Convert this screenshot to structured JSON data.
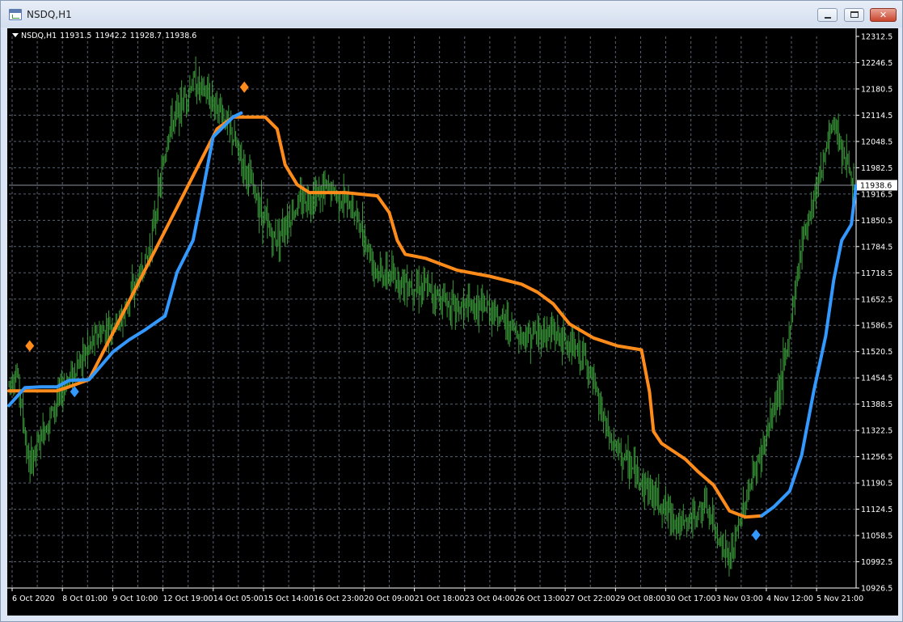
{
  "window": {
    "title": "NSDQ,H1",
    "close_glyph": "✕"
  },
  "info_bar": {
    "symbol": "NSDQ,H1",
    "open": "11931.5",
    "high": "11942.2",
    "low": "11928.7",
    "close": "11938.6"
  },
  "colors": {
    "background": "#000000",
    "grid": "#596273",
    "candles": "#3a9a3a",
    "upper_line": "#ff8c1a",
    "lower_line": "#3399ff",
    "axis_text": "#ffffff",
    "current_price_bg": "#ffffff"
  },
  "chart_data": {
    "type": "line",
    "symbol": "NSDQ",
    "timeframe": "H1",
    "current_price": 11938.6,
    "ylim": [
      10926.6,
      12312.5
    ],
    "y_ticks": [
      "12312.5",
      "12246.5",
      "12180.5",
      "12114.5",
      "12048.5",
      "11982.5",
      "11916.5",
      "11850.5",
      "11784.5",
      "11718.5",
      "11652.5",
      "11586.5",
      "11520.5",
      "11454.5",
      "11388.5",
      "11322.5",
      "11256.5",
      "11190.5",
      "11124.5",
      "11058.5",
      "10992.5",
      "10926.5"
    ],
    "x_ticks": [
      "6 Oct 2020",
      "8 Oct 01:00",
      "9 Oct 10:00",
      "12 Oct 19:00",
      "14 Oct 05:00",
      "15 Oct 14:00",
      "16 Oct 23:00",
      "20 Oct 09:00",
      "21 Oct 18:00",
      "23 Oct 04:00",
      "26 Oct 13:00",
      "27 Oct 22:00",
      "29 Oct 08:00",
      "30 Oct 17:00",
      "3 Nov 03:00",
      "4 Nov 12:00",
      "5 Nov 21:00"
    ],
    "bars_count": 720,
    "price_path": [
      [
        0,
        11440
      ],
      [
        10,
        11470
      ],
      [
        25,
        11230
      ],
      [
        45,
        11330
      ],
      [
        70,
        11440
      ],
      [
        110,
        11560
      ],
      [
        140,
        11600
      ],
      [
        175,
        11770
      ],
      [
        200,
        12080
      ],
      [
        230,
        12200
      ],
      [
        265,
        12130
      ],
      [
        295,
        11980
      ],
      [
        330,
        11800
      ],
      [
        365,
        11900
      ],
      [
        400,
        11930
      ],
      [
        430,
        11880
      ],
      [
        460,
        11720
      ],
      [
        490,
        11700
      ],
      [
        520,
        11680
      ],
      [
        560,
        11630
      ],
      [
        600,
        11630
      ],
      [
        640,
        11560
      ],
      [
        680,
        11570
      ],
      [
        720,
        11500
      ],
      [
        750,
        11300
      ],
      [
        780,
        11220
      ],
      [
        810,
        11150
      ],
      [
        840,
        11080
      ],
      [
        870,
        11130
      ],
      [
        900,
        10990
      ],
      [
        920,
        11150
      ],
      [
        945,
        11300
      ],
      [
        970,
        11500
      ],
      [
        990,
        11800
      ],
      [
        1010,
        11950
      ],
      [
        1030,
        12100
      ],
      [
        1055,
        11940
      ]
    ],
    "series": [
      {
        "name": "upper",
        "color": "#ff8c1a",
        "points": [
          [
            0,
            11422
          ],
          [
            60,
            11422
          ],
          [
            75,
            11432
          ],
          [
            100,
            11450
          ],
          [
            260,
            12080
          ],
          [
            280,
            12110
          ],
          [
            320,
            12110
          ],
          [
            335,
            12080
          ],
          [
            345,
            11990
          ],
          [
            360,
            11940
          ],
          [
            375,
            11920
          ],
          [
            420,
            11920
          ],
          [
            460,
            11912
          ],
          [
            475,
            11870
          ],
          [
            485,
            11800
          ],
          [
            495,
            11765
          ],
          [
            520,
            11755
          ],
          [
            560,
            11725
          ],
          [
            600,
            11710
          ],
          [
            640,
            11690
          ],
          [
            660,
            11670
          ],
          [
            680,
            11640
          ],
          [
            700,
            11590
          ],
          [
            730,
            11555
          ],
          [
            760,
            11535
          ],
          [
            790,
            11525
          ],
          [
            800,
            11420
          ],
          [
            805,
            11320
          ],
          [
            815,
            11290
          ],
          [
            830,
            11270
          ],
          [
            845,
            11250
          ],
          [
            860,
            11220
          ],
          [
            880,
            11185
          ],
          [
            900,
            11120
          ],
          [
            920,
            11105
          ],
          [
            940,
            11108
          ]
        ]
      },
      {
        "name": "lower",
        "color": "#3399ff",
        "points": [
          [
            0,
            11385
          ],
          [
            20,
            11430
          ],
          [
            40,
            11432
          ],
          [
            60,
            11432
          ],
          [
            75,
            11448
          ],
          [
            100,
            11450
          ],
          [
            130,
            11520
          ],
          [
            150,
            11550
          ],
          [
            170,
            11575
          ],
          [
            195,
            11610
          ],
          [
            210,
            11720
          ],
          [
            230,
            11800
          ],
          [
            240,
            11900
          ],
          [
            255,
            12060
          ],
          [
            280,
            12110
          ],
          [
            290,
            12120
          ],
          [
            940,
            11108
          ],
          [
            955,
            11130
          ],
          [
            975,
            11170
          ],
          [
            990,
            11260
          ],
          [
            1005,
            11420
          ],
          [
            1020,
            11560
          ],
          [
            1030,
            11700
          ],
          [
            1040,
            11800
          ],
          [
            1052,
            11840
          ],
          [
            1058,
            11938
          ]
        ]
      }
    ],
    "markers": [
      {
        "x": 26,
        "y": 11535,
        "color": "#ff8c1a"
      },
      {
        "x": 82,
        "y": 11420,
        "color": "#3399ff"
      },
      {
        "x": 294,
        "y": 12185,
        "color": "#ff8c1a"
      },
      {
        "x": 933,
        "y": 11060,
        "color": "#3399ff"
      }
    ]
  }
}
